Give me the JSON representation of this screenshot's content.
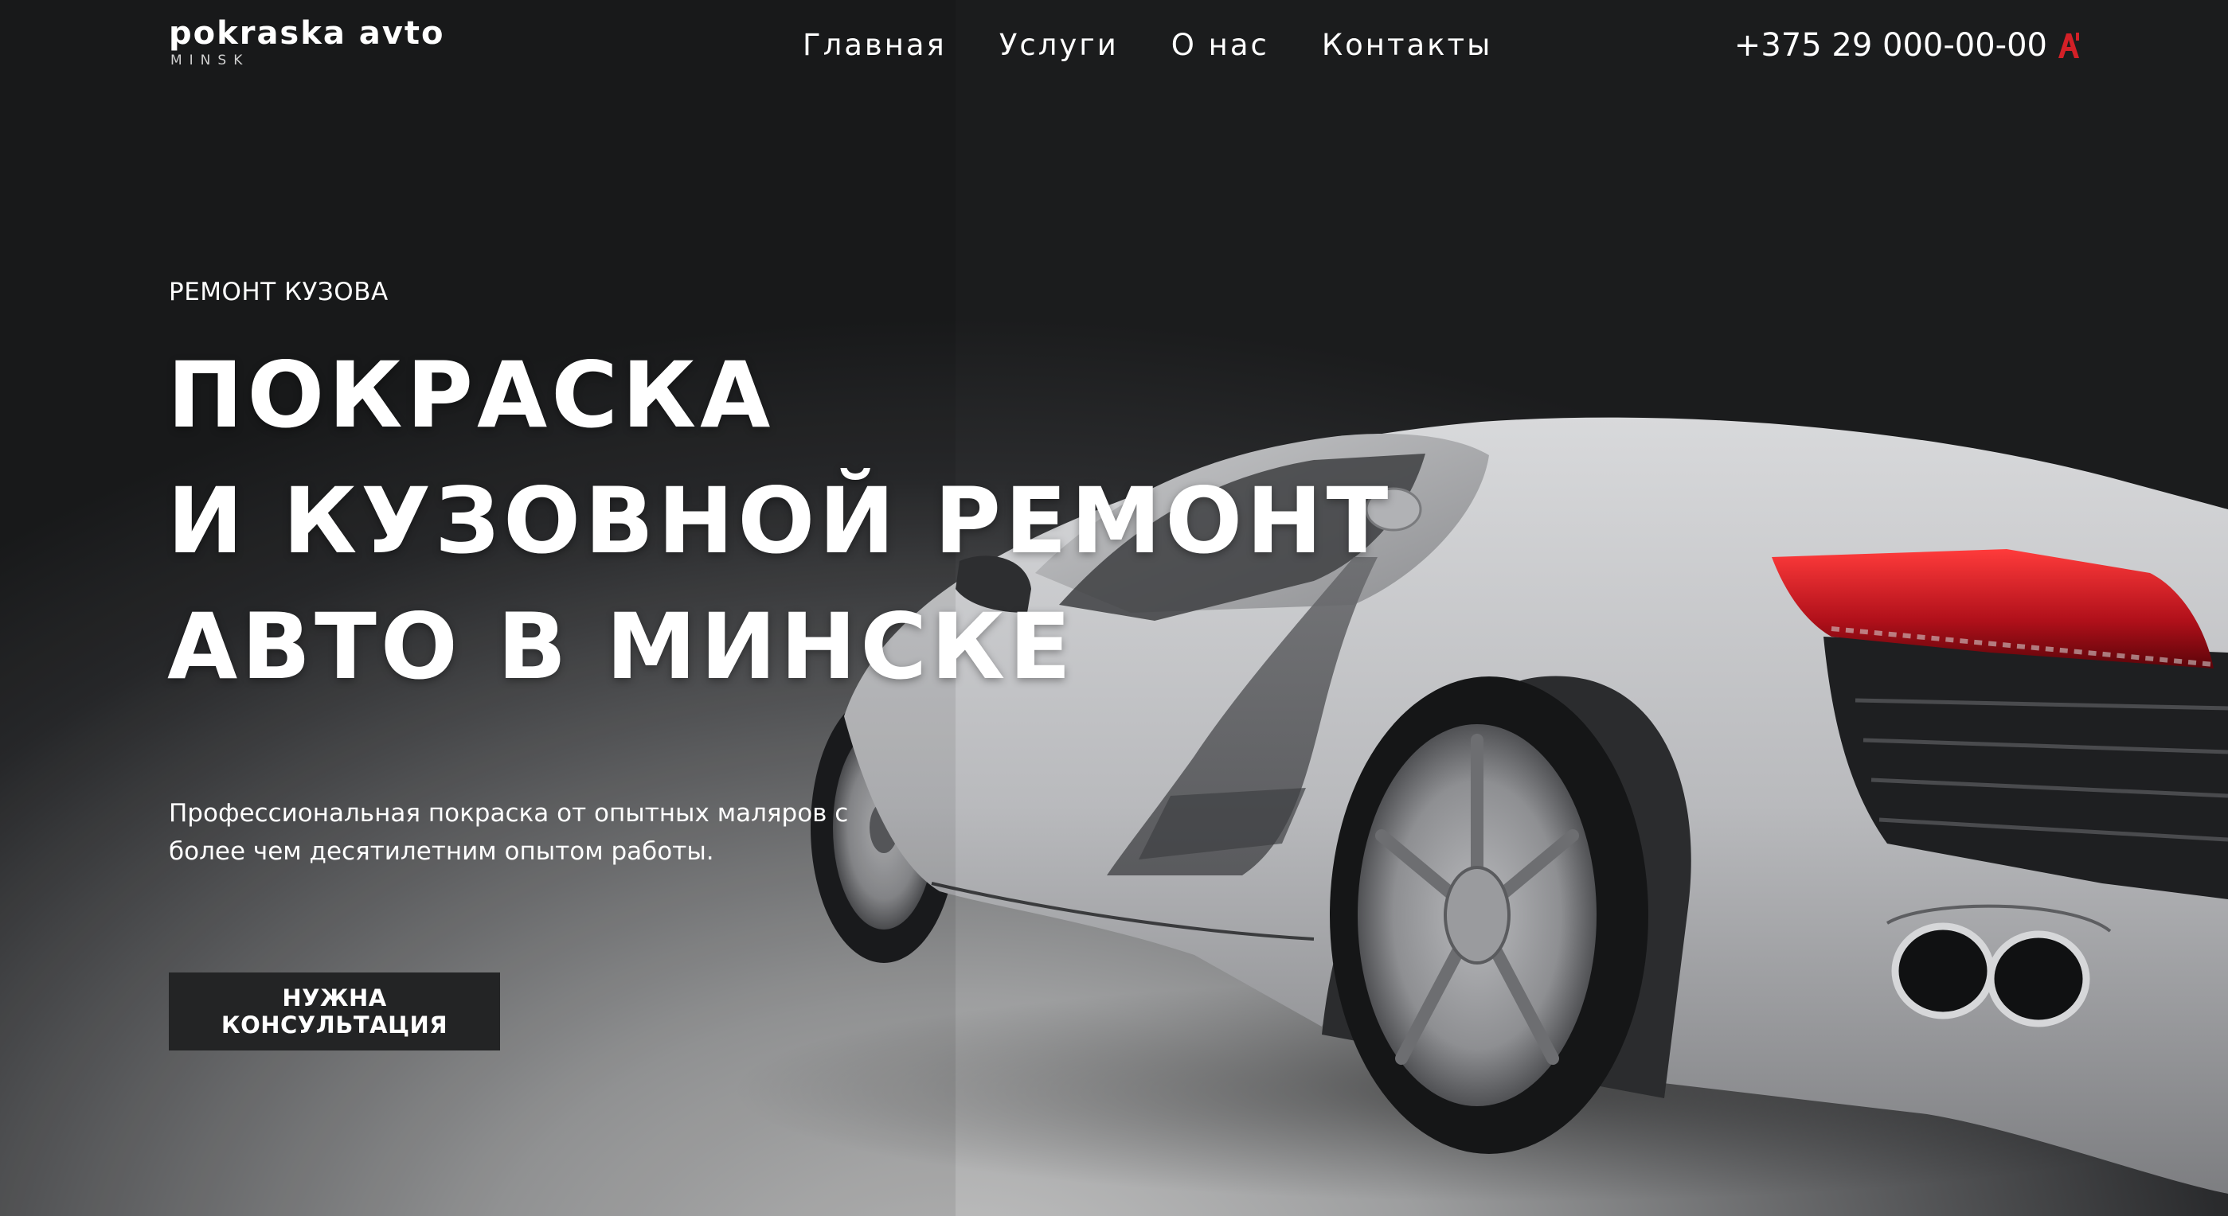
{
  "logo": {
    "title": "pokraska avto",
    "subtitle": "MINSK"
  },
  "nav": {
    "items": [
      "Главная",
      "Услуги",
      "О нас",
      "Контакты"
    ]
  },
  "header": {
    "phone": "+375 29 000-00-00",
    "phone_icon": "a-letter-icon"
  },
  "hero": {
    "eyebrow": "РЕМОНТ КУЗОВА",
    "headline_lines": [
      "ПОКРАСКА",
      "И КУЗОВНОЙ РЕМОНТ",
      "АВТО В МИНСКЕ"
    ],
    "description": "Профессиональная покраска от опытных маляров с более чем десятилетним опытом работы.",
    "cta_label": "НУЖНА КОНСУЛЬТАЦИЯ",
    "image": "white-sports-car"
  },
  "colors": {
    "background_dark": "#1b1c1d",
    "background_light": "#c4c4c4",
    "button_bg": "#232425",
    "accent_red": "#d32027",
    "text": "#ffffff"
  }
}
